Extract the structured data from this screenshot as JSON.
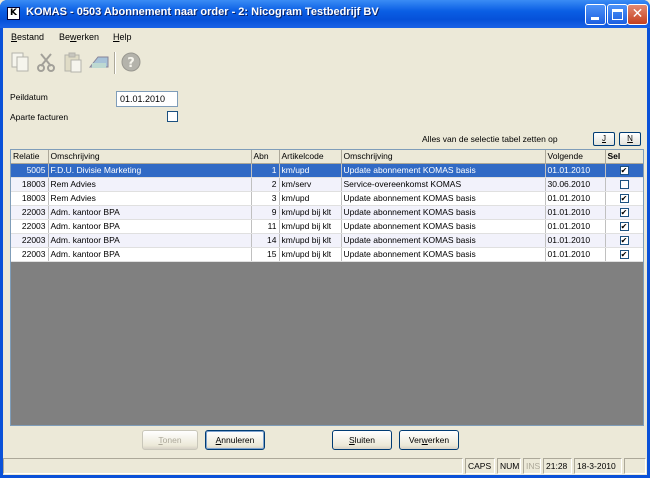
{
  "window": {
    "title": "KOMAS - 0503 Abonnement naar order - 2: Nicogram Testbedrijf BV",
    "icon": "K"
  },
  "menu": [
    {
      "pre": "",
      "key": "B",
      "post": "estand"
    },
    {
      "pre": "Be",
      "key": "w",
      "post": "erken"
    },
    {
      "pre": "",
      "key": "H",
      "post": "elp"
    }
  ],
  "toolbar": {
    "icons": [
      "copy-icon",
      "cut-icon",
      "paste-icon",
      "find-icon",
      "help-icon"
    ]
  },
  "form": {
    "peildatum_label": "Peildatum",
    "peildatum_value": "01.01.2010",
    "aparte_label": "Aparte facturen",
    "aparte_checked": false,
    "selectie_text": "Alles van de selectie tabel zetten op",
    "btn_j": "J",
    "btn_n": "N"
  },
  "table": {
    "columns": [
      "Relatie",
      "Omschrijving",
      "Abn",
      "Artikelcode",
      "Omschrijving",
      "Volgende",
      "Sel"
    ],
    "rows": [
      {
        "relatie": "5005",
        "omschrijving": "F.D.U. Divisie Marketing",
        "abn": "1",
        "artikelcode": "km/upd",
        "omschrijving2": "Update abonnement KOMAS basis",
        "volgende": "01.01.2010",
        "sel": true
      },
      {
        "relatie": "18003",
        "omschrijving": "Rem Advies",
        "abn": "2",
        "artikelcode": "km/serv",
        "omschrijving2": "Service-overeenkomst KOMAS",
        "volgende": "30.06.2010",
        "sel": false
      },
      {
        "relatie": "18003",
        "omschrijving": "Rem Advies",
        "abn": "3",
        "artikelcode": "km/upd",
        "omschrijving2": "Update abonnement KOMAS basis",
        "volgende": "01.01.2010",
        "sel": true
      },
      {
        "relatie": "22003",
        "omschrijving": "Adm. kantoor BPA",
        "abn": "9",
        "artikelcode": "km/upd bij klt",
        "omschrijving2": "Update abonnement KOMAS basis",
        "volgende": "01.01.2010",
        "sel": true
      },
      {
        "relatie": "22003",
        "omschrijving": "Adm. kantoor BPA",
        "abn": "11",
        "artikelcode": "km/upd bij klt",
        "omschrijving2": "Update abonnement KOMAS basis",
        "volgende": "01.01.2010",
        "sel": true
      },
      {
        "relatie": "22003",
        "omschrijving": "Adm. kantoor BPA",
        "abn": "14",
        "artikelcode": "km/upd bij klt",
        "omschrijving2": "Update abonnement KOMAS basis",
        "volgende": "01.01.2010",
        "sel": true
      },
      {
        "relatie": "22003",
        "omschrijving": "Adm. kantoor BPA",
        "abn": "15",
        "artikelcode": "km/upd bij klt",
        "omschrijving2": "Update abonnement KOMAS basis",
        "volgende": "01.01.2010",
        "sel": true
      }
    ]
  },
  "buttons": {
    "tonen": {
      "pre": "",
      "key": "T",
      "post": "onen"
    },
    "annuleren": {
      "pre": "",
      "key": "A",
      "post": "nnuleren"
    },
    "sluiten": {
      "pre": "",
      "key": "S",
      "post": "luiten"
    },
    "verwerken": {
      "pre": "Ver",
      "key": "w",
      "post": "erken"
    }
  },
  "status": {
    "caps": "CAPS",
    "num": "NUM",
    "ins": "INS",
    "time": "21:28",
    "date": "18-3-2010"
  },
  "colors": {
    "selection": "#316ac5",
    "titlebar": "#0a5ee4"
  }
}
